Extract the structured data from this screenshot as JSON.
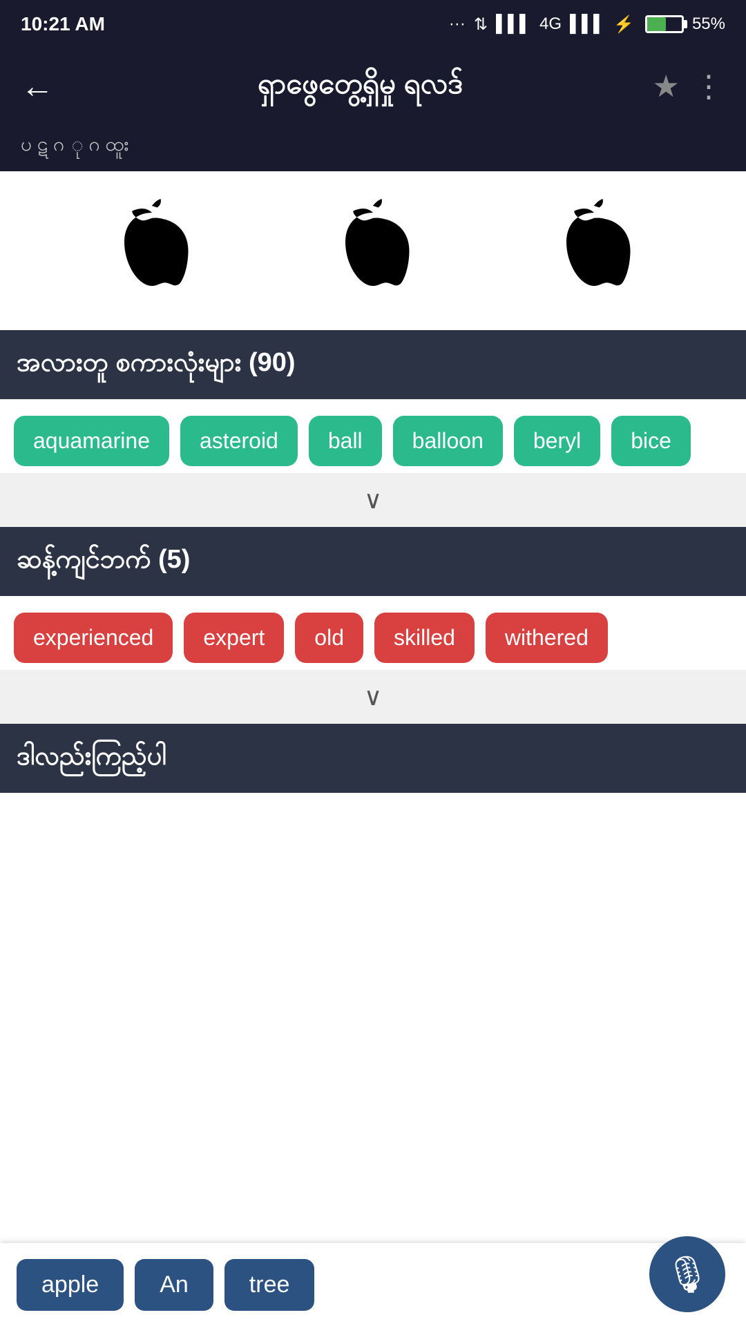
{
  "statusBar": {
    "time": "10:21 AM",
    "battery": "55%",
    "network": "4G"
  },
  "header": {
    "title": "ရှာဖွေတွေ့ရှိမှု ရလဒ်",
    "subtitle": "ပ  ဋ  ဂ  ု  ဂ        ထူး",
    "backLabel": "←",
    "moreLabel": "⋮"
  },
  "sections": {
    "related": {
      "label": "အလားတူ စကားလုံးများ",
      "count": "(90)",
      "tags": [
        "aquamarine",
        "asteroid",
        "ball",
        "balloon",
        "beryl",
        "bice"
      ]
    },
    "synonyms": {
      "label": "ဆန့်ကျင်ဘက်",
      "count": "(5)",
      "tags": [
        "experienced",
        "expert",
        "old",
        "skilled",
        "withered"
      ]
    },
    "thirdSection": {
      "label": "ဒါလည်းကြည့်ပါ"
    }
  },
  "bottomBar": {
    "tags": [
      "apple",
      "An",
      "tree"
    ]
  },
  "icons": {
    "apple1": "🍎",
    "apple2": "🍎",
    "apple3": "🍎",
    "mic": "🎙"
  }
}
